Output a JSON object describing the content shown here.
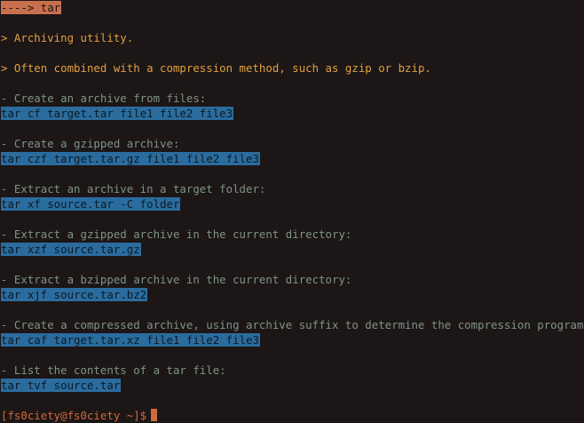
{
  "header": "----> tar",
  "descriptions": [
    "> Archiving utility.",
    "> Often combined with a compression method, such as gzip or bzip."
  ],
  "examples": [
    {
      "step": "- Create an archive from files:",
      "command": "tar cf target.tar file1 file2 file3"
    },
    {
      "step": "- Create a gzipped archive:",
      "command": "tar czf target.tar.gz file1 file2 file3"
    },
    {
      "step": "- Extract an archive in a target folder:",
      "command": "tar xf source.tar -C folder"
    },
    {
      "step": "- Extract a gzipped archive in the current directory:",
      "command": "tar xzf source.tar.gz"
    },
    {
      "step": "- Extract a bzipped archive in the current directory:",
      "command": "tar xjf source.tar.bz2"
    },
    {
      "step": "- Create a compressed archive, using archive suffix to determine the compression program:",
      "command": "tar caf target.tar.xz file1 file2 file3"
    },
    {
      "step": "- List the contents of a tar file:",
      "command": "tar tvf source.tar"
    }
  ],
  "prompt": "[fs0ciety@fs0ciety ~]$"
}
